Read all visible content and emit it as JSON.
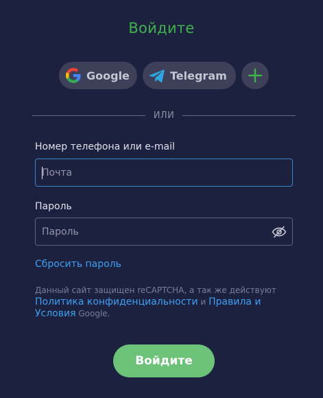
{
  "page": {
    "title": "Войдите"
  },
  "social": {
    "google_label": "Google",
    "telegram_label": "Telegram",
    "more_icon": "plus-icon"
  },
  "divider_text": "ИЛИ",
  "login_field": {
    "label": "Номер телефона или e-mail",
    "placeholder": "Почта",
    "value": ""
  },
  "password_field": {
    "label": "Пароль",
    "placeholder": "Пароль",
    "value": "",
    "toggle_icon": "eye-slash-icon"
  },
  "reset_link": "Сбросить пароль",
  "recaptcha": {
    "text_1": "Данный сайт защищен reCAPTCHA, а так же действуют",
    "privacy_link": "Политика конфиденциальности",
    "and": "и",
    "terms_link": "Правила и Условия",
    "suffix": "Google."
  },
  "submit_label": "Войдите",
  "colors": {
    "background": "#1d2140",
    "title_green": "#3fb24a",
    "link_blue": "#3e9ff0",
    "button_green": "#6cc279",
    "social_bg": "#3d4058"
  }
}
